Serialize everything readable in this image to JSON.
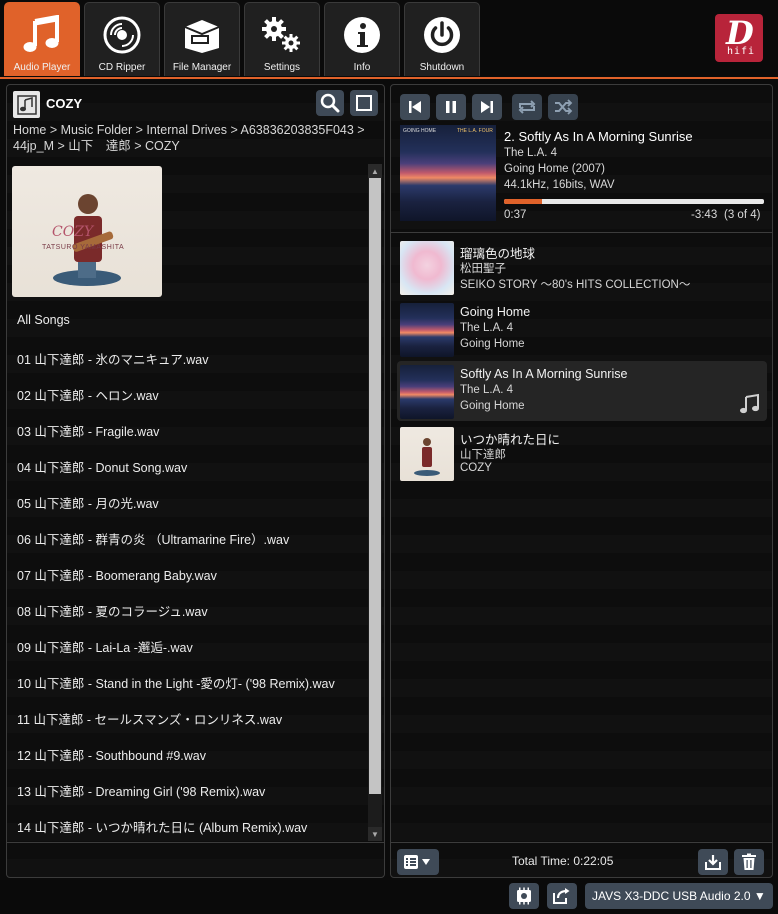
{
  "nav": {
    "tabs": [
      {
        "label": "Audio Player",
        "icon": "music-note-icon",
        "active": true
      },
      {
        "label": "CD Ripper",
        "icon": "disc-icon",
        "active": false
      },
      {
        "label": "File Manager",
        "icon": "folder-box-icon",
        "active": false
      },
      {
        "label": "Settings",
        "icon": "gears-icon",
        "active": false
      },
      {
        "label": "Info",
        "icon": "info-icon",
        "active": false
      },
      {
        "label": "Shutdown",
        "icon": "power-icon",
        "active": false
      }
    ],
    "logo_letter": "D",
    "logo_sub": "hifi"
  },
  "browser": {
    "folder_title": "COZY",
    "breadcrumb": "Home > Music Folder > Internal Drives > A63836203835F043 > 44jp_M > 山下　達郎 > COZY",
    "all_songs_label": "All Songs",
    "songs": [
      "01 山下達郎 - 氷のマニキュア.wav",
      "02 山下達郎 - ヘロン.wav",
      "03 山下達郎 - Fragile.wav",
      "04 山下達郎 - Donut Song.wav",
      "05 山下達郎 - 月の光.wav",
      "06 山下達郎 - 群青の炎 （Ultramarine Fire）.wav",
      "07 山下達郎 - Boomerang Baby.wav",
      "08 山下達郎 - 夏のコラージュ.wav",
      "09 山下達郎 - Lai-La -邂逅-.wav",
      "10 山下達郎 - Stand in the Light -愛の灯- ('98 Remix).wav",
      "11 山下達郎 - セールスマンズ・ロンリネス.wav",
      "12 山下達郎 - Southbound #9.wav",
      "13 山下達郎 - Dreaming Girl ('98 Remix).wav",
      "14 山下達郎 - いつか晴れた日に (Album Remix).wav"
    ],
    "cover_text": "COZY",
    "cover_artist": "TATSURO YAMASHITA"
  },
  "player": {
    "title": "2. Softly As In A Morning Sunrise",
    "artist": "The L.A. 4",
    "album": "Going Home (2007)",
    "format": "44.1kHz, 16bits, WAV",
    "elapsed": "0:37",
    "remaining": "-3:43",
    "position": "(3 of 4)",
    "progress": 0.145,
    "cover_text_left": "GOING HOME",
    "cover_text_right": "THE L.A. FOUR"
  },
  "queue": [
    {
      "title": "瑠璃色の地球",
      "artist": "松田聖子",
      "album": "SEIKO STORY 〜80's HITS COLLECTION〜",
      "art": "seiko",
      "current": false
    },
    {
      "title": "Going Home",
      "artist": "The L.A. 4",
      "album": "Going Home",
      "art": "sunset",
      "current": false
    },
    {
      "title": "Softly As In A Morning Sunrise",
      "artist": "The L.A. 4",
      "album": "Going Home",
      "art": "sunset",
      "current": true
    },
    {
      "title": "いつか晴れた日に",
      "artist": "山下達郎",
      "album": "COZY",
      "art": "cozy",
      "current": false
    }
  ],
  "queue_footer": {
    "total_time": "Total Time: 0:22:05"
  },
  "statusbar": {
    "device": "JAVS X3-DDC USB Audio 2.0 ▼"
  },
  "colors": {
    "accent": "#e0622a",
    "button_bg": "#3f4a57",
    "logo_red": "#b8243a",
    "progress_fill": "#e0622a"
  }
}
